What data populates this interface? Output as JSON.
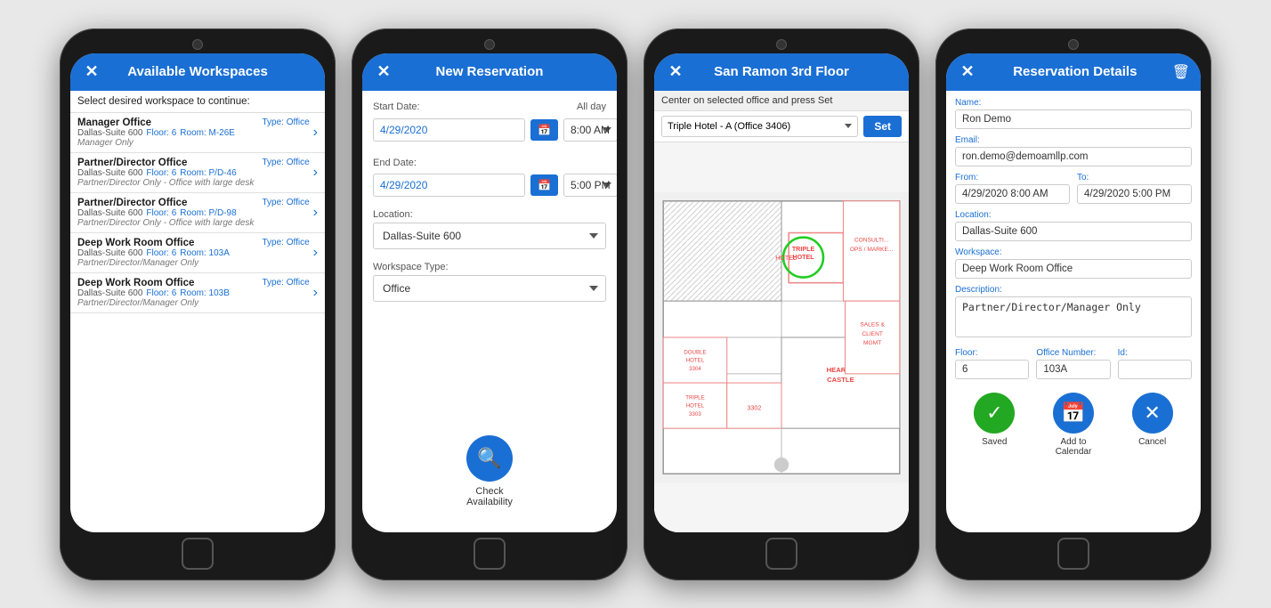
{
  "phone1": {
    "header": "Available Workspaces",
    "subtitle": "Select desired workspace to continue:",
    "items": [
      {
        "name": "Manager Office",
        "type": "Type: Office",
        "location": "Dallas-Suite 600",
        "floor": "Floor: 6",
        "room": "Room: M-26E",
        "desc": "Manager Only"
      },
      {
        "name": "Partner/Director Office",
        "type": "Type: Office",
        "location": "Dallas-Suite 600",
        "floor": "Floor: 6",
        "room": "Room: P/D-46",
        "desc": "Partner/Director Only - Office with large desk"
      },
      {
        "name": "Partner/Director Office",
        "type": "Type: Office",
        "location": "Dallas-Suite 600",
        "floor": "Floor: 6",
        "room": "Room: P/D-98",
        "desc": "Partner/Director Only - Office with large desk"
      },
      {
        "name": "Deep Work Room Office",
        "type": "Type: Office",
        "location": "Dallas-Suite 600",
        "floor": "Floor: 6",
        "room": "Room: 103A",
        "desc": "Partner/Director/Manager Only"
      },
      {
        "name": "Deep Work Room Office",
        "type": "Type: Office",
        "location": "Dallas-Suite 600",
        "floor": "Floor: 6",
        "room": "Room: 103B",
        "desc": "Partner/Director/Manager Only"
      }
    ]
  },
  "phone2": {
    "header": "New Reservation",
    "startLabel": "Start Date:",
    "startDate": "4/29/2020",
    "startTime": "8:00 AM",
    "alldayLabel": "All day",
    "endLabel": "End Date:",
    "endDate": "4/29/2020",
    "endTime": "5:00 PM",
    "locationLabel": "Location:",
    "locationValue": "Dallas-Suite 600",
    "workspaceTypeLabel": "Workspace Type:",
    "workspaceTypeValue": "Office",
    "checkLabel": "Check\nAvailability"
  },
  "phone3": {
    "header": "San Ramon 3rd Floor",
    "instruction": "Center on selected office and press Set",
    "dropdownValue": "Triple Hotel - A (Office 3406)",
    "setButton": "Set"
  },
  "phone4": {
    "header": "Reservation Details",
    "nameLabel": "Name:",
    "nameValue": "Ron Demo",
    "emailLabel": "Email:",
    "emailValue": "ron.demo@demoamllp.com",
    "fromLabel": "From:",
    "fromValue": "4/29/2020 8:00 AM",
    "toLabel": "To:",
    "toValue": "4/29/2020 5:00 PM",
    "locationLabel": "Location:",
    "locationValue": "Dallas-Suite 600",
    "workspaceLabel": "Workspace:",
    "workspaceValue": "Deep Work Room Office",
    "descLabel": "Description:",
    "descValue": "Partner/Director/Manager Only",
    "floorLabel": "Floor:",
    "floorValue": "6",
    "officeNumLabel": "Office Number:",
    "officeNumValue": "103A",
    "idLabel": "Id:",
    "idValue": "",
    "savedLabel": "Saved",
    "calendarLabel": "Add to\nCalendar",
    "cancelLabel": "Cancel"
  }
}
